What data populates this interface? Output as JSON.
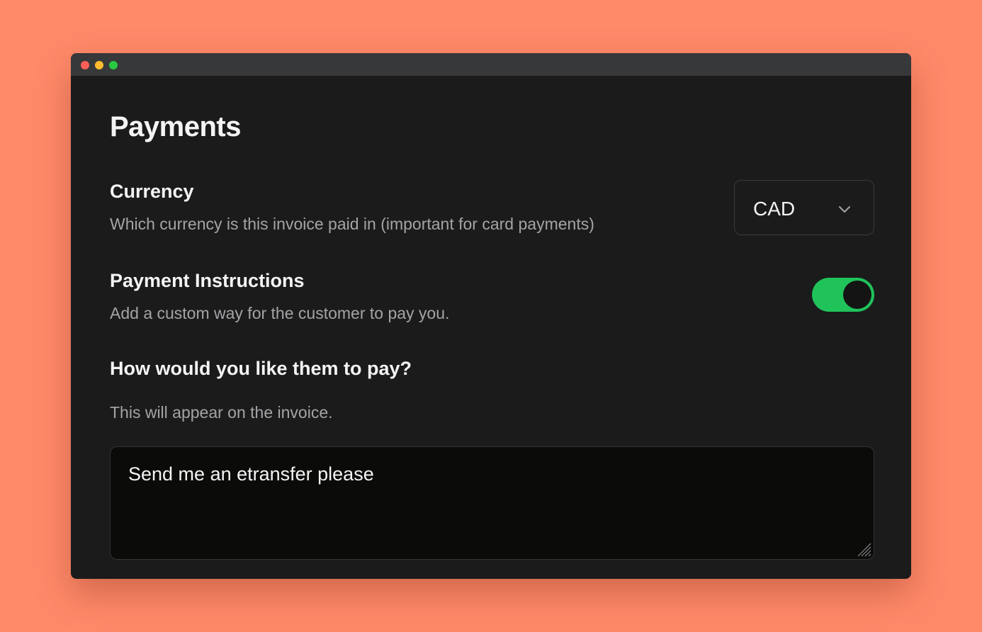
{
  "page": {
    "title": "Payments"
  },
  "currency": {
    "title": "Currency",
    "description": "Which currency is this invoice paid in (important for card payments)",
    "selected": "CAD"
  },
  "payment_instructions": {
    "title": "Payment Instructions",
    "description": "Add a custom way for the customer to pay you.",
    "enabled": true
  },
  "how_to_pay": {
    "title": "How would you like them to pay?",
    "description": "This will appear on the invoice.",
    "value": "Send me an etransfer please"
  },
  "colors": {
    "background": "#ff8a6a",
    "window": "#1b1b1b",
    "titlebar": "#37383a",
    "toggle_on": "#1fc35a",
    "text_primary": "#f4f4f4",
    "text_secondary": "#a4a4a8"
  },
  "icons": {
    "dropdown": "chevron-down-icon",
    "resize": "resize-handle-icon"
  }
}
